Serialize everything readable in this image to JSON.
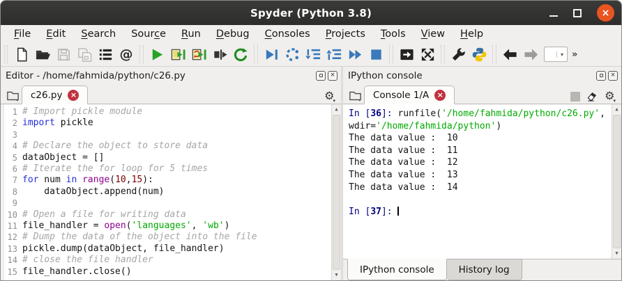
{
  "window": {
    "title": "Spyder (Python 3.8)",
    "controls": [
      "minimize",
      "maximize",
      "close"
    ]
  },
  "menu_bar": {
    "items": [
      {
        "label": "File",
        "underline": 0
      },
      {
        "label": "Edit",
        "underline": 0
      },
      {
        "label": "Search",
        "underline": 0
      },
      {
        "label": "Source",
        "underline": 4
      },
      {
        "label": "Run",
        "underline": 0
      },
      {
        "label": "Debug",
        "underline": 0
      },
      {
        "label": "Consoles",
        "underline": 0
      },
      {
        "label": "Projects",
        "underline": 0
      },
      {
        "label": "Tools",
        "underline": 0
      },
      {
        "label": "View",
        "underline": 0
      },
      {
        "label": "Help",
        "underline": 0
      }
    ]
  },
  "toolbar": {
    "icon_names": [
      "new-file",
      "open-file",
      "save-file",
      "save-all",
      "file-switcher",
      "find-symbols",
      "run-file",
      "run-cell",
      "rerun-cell-advance",
      "run-selection",
      "rerun-script",
      "debug-file",
      "step-over",
      "step-into",
      "step-return",
      "continue-execution",
      "stop-debugging",
      "maximize-pane",
      "fullscreen",
      "preferences",
      "python-path-manager",
      "back",
      "forward",
      "cursor-position-dropdown",
      "toolbar-overflow"
    ],
    "overflow_glyph": "»"
  },
  "editor_pane": {
    "title": "Editor - /home/fahmida/python/c26.py",
    "tab_label": "c26.py",
    "code_lines": [
      {
        "num": 1,
        "tokens": [
          [
            "comment",
            "# Import pickle module"
          ]
        ]
      },
      {
        "num": 2,
        "tokens": [
          [
            "keyword",
            "import"
          ],
          [
            "plain",
            " pickle"
          ]
        ]
      },
      {
        "num": 3,
        "tokens": []
      },
      {
        "num": 4,
        "tokens": [
          [
            "comment",
            "# Declare the object to store data"
          ]
        ]
      },
      {
        "num": 5,
        "tokens": [
          [
            "plain",
            "dataObject = []"
          ]
        ]
      },
      {
        "num": 6,
        "tokens": [
          [
            "comment",
            "# Iterate the for loop for 5 times"
          ]
        ]
      },
      {
        "num": 7,
        "tokens": [
          [
            "keyword",
            "for"
          ],
          [
            "plain",
            " num "
          ],
          [
            "keyword",
            "in"
          ],
          [
            "plain",
            " "
          ],
          [
            "builtin",
            "range"
          ],
          [
            "plain",
            "("
          ],
          [
            "number",
            "10"
          ],
          [
            "plain",
            ","
          ],
          [
            "number",
            "15"
          ],
          [
            "plain",
            "):"
          ]
        ]
      },
      {
        "num": 8,
        "tokens": [
          [
            "plain",
            "    dataObject.append(num)"
          ]
        ]
      },
      {
        "num": 9,
        "tokens": []
      },
      {
        "num": 10,
        "tokens": [
          [
            "comment",
            "# Open a file for writing data"
          ]
        ]
      },
      {
        "num": 11,
        "tokens": [
          [
            "plain",
            "file_handler = "
          ],
          [
            "builtin",
            "open"
          ],
          [
            "plain",
            "("
          ],
          [
            "string",
            "'languages'"
          ],
          [
            "plain",
            ", "
          ],
          [
            "string",
            "'wb'"
          ],
          [
            "plain",
            ")"
          ]
        ]
      },
      {
        "num": 12,
        "tokens": [
          [
            "comment",
            "# Dump the data of the object into the file"
          ]
        ]
      },
      {
        "num": 13,
        "tokens": [
          [
            "plain",
            "pickle.dump(dataObject, file_handler)"
          ]
        ]
      },
      {
        "num": 14,
        "tokens": [
          [
            "comment",
            "# close the file handler"
          ]
        ]
      },
      {
        "num": 15,
        "tokens": [
          [
            "plain",
            "file_handler.close()"
          ]
        ]
      }
    ]
  },
  "console_pane": {
    "title": "IPython console",
    "tab_label": "Console 1/A",
    "lines": [
      {
        "tokens": [
          [
            "prompt",
            "In ["
          ],
          [
            "promptnum",
            "36"
          ],
          [
            "prompt",
            "]: "
          ],
          [
            "plain",
            "runfile("
          ],
          [
            "string",
            "'/home/fahmida/python/c26.py'"
          ],
          [
            "plain",
            ","
          ]
        ]
      },
      {
        "tokens": [
          [
            "plain",
            "wdir="
          ],
          [
            "string",
            "'/home/fahmida/python'"
          ],
          [
            "plain",
            ")"
          ]
        ]
      },
      {
        "tokens": [
          [
            "plain",
            "The data value :  10"
          ]
        ]
      },
      {
        "tokens": [
          [
            "plain",
            "The data value :  11"
          ]
        ]
      },
      {
        "tokens": [
          [
            "plain",
            "The data value :  12"
          ]
        ]
      },
      {
        "tokens": [
          [
            "plain",
            "The data value :  13"
          ]
        ]
      },
      {
        "tokens": [
          [
            "plain",
            "The data value :  14"
          ]
        ]
      },
      {
        "tokens": []
      },
      {
        "tokens": [
          [
            "prompt",
            "In ["
          ],
          [
            "promptnum",
            "37"
          ],
          [
            "prompt",
            "]: "
          ],
          [
            "cursor",
            "|"
          ]
        ]
      }
    ],
    "bottom_tabs": [
      {
        "label": "IPython console",
        "active": true
      },
      {
        "label": "History log",
        "active": false
      }
    ]
  },
  "colors": {
    "titlebar_bg": "#323231",
    "window_close_button": "#e95420",
    "tab_close_badge": "#c13240",
    "run_green": "#27a327",
    "debug_blue": "#3a79bb",
    "panel_bg": "#f0efed",
    "keyword": "#2430d6",
    "builtin": "#900090",
    "string": "#00aa00",
    "number": "#800000",
    "comment": "#a6a6a6",
    "prompt": "#000080"
  }
}
